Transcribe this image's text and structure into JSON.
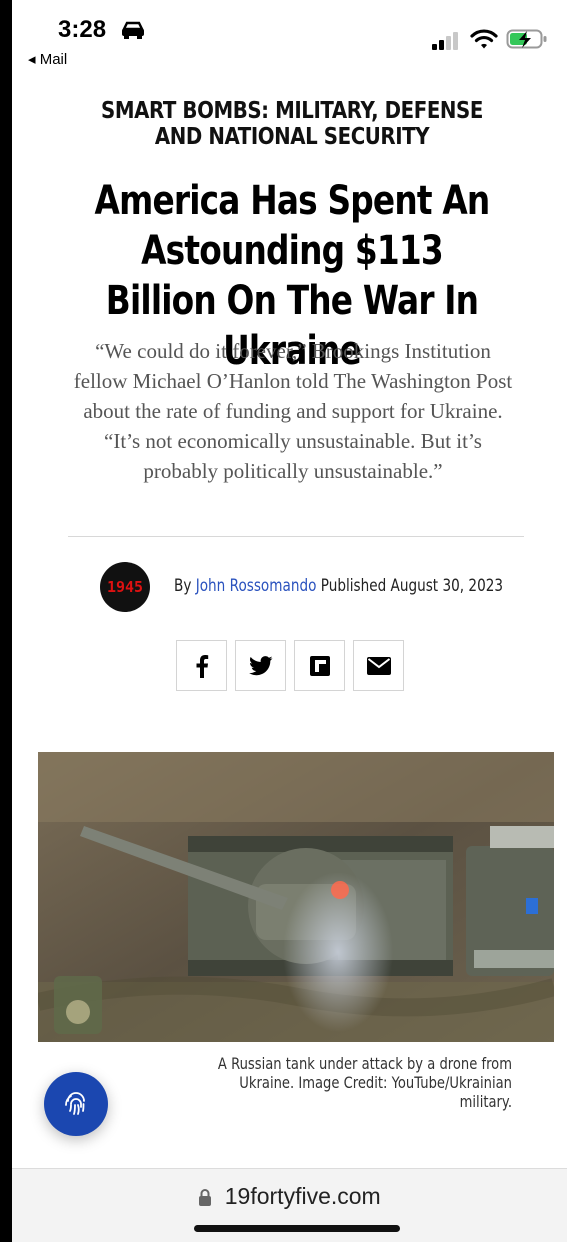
{
  "status_bar": {
    "time": "3:28",
    "back_label": "◂ Mail"
  },
  "article": {
    "kicker": "SMART BOMBS: MILITARY, DEFENSE AND NATIONAL SECURITY",
    "headline": "America Has Spent An Astounding $113 Billion On The War In Ukraine",
    "dek": "“We could do it forever,” Brookings Institution fellow Michael O’Hanlon told The Washington Post about the rate of funding and support for Ukraine. “It’s not economically unsustainable. But it’s probably politically unsustainable.”",
    "byline": {
      "logo_text": "1945",
      "by_label": "By",
      "author": "John Rossomando",
      "published_label": "Published",
      "date": "August 30, 2023"
    },
    "share_icons": [
      "facebook-icon",
      "twitter-icon",
      "flipboard-icon",
      "email-icon"
    ],
    "image_caption": "A Russian tank under attack by a drone from Ukraine. Image Credit: YouTube/Ukrainian military."
  },
  "browser": {
    "url": "19fortyfive.com"
  },
  "colors": {
    "author_link": "#2a52be",
    "fab": "#1b47b0",
    "logo_text": "#dd1111"
  }
}
